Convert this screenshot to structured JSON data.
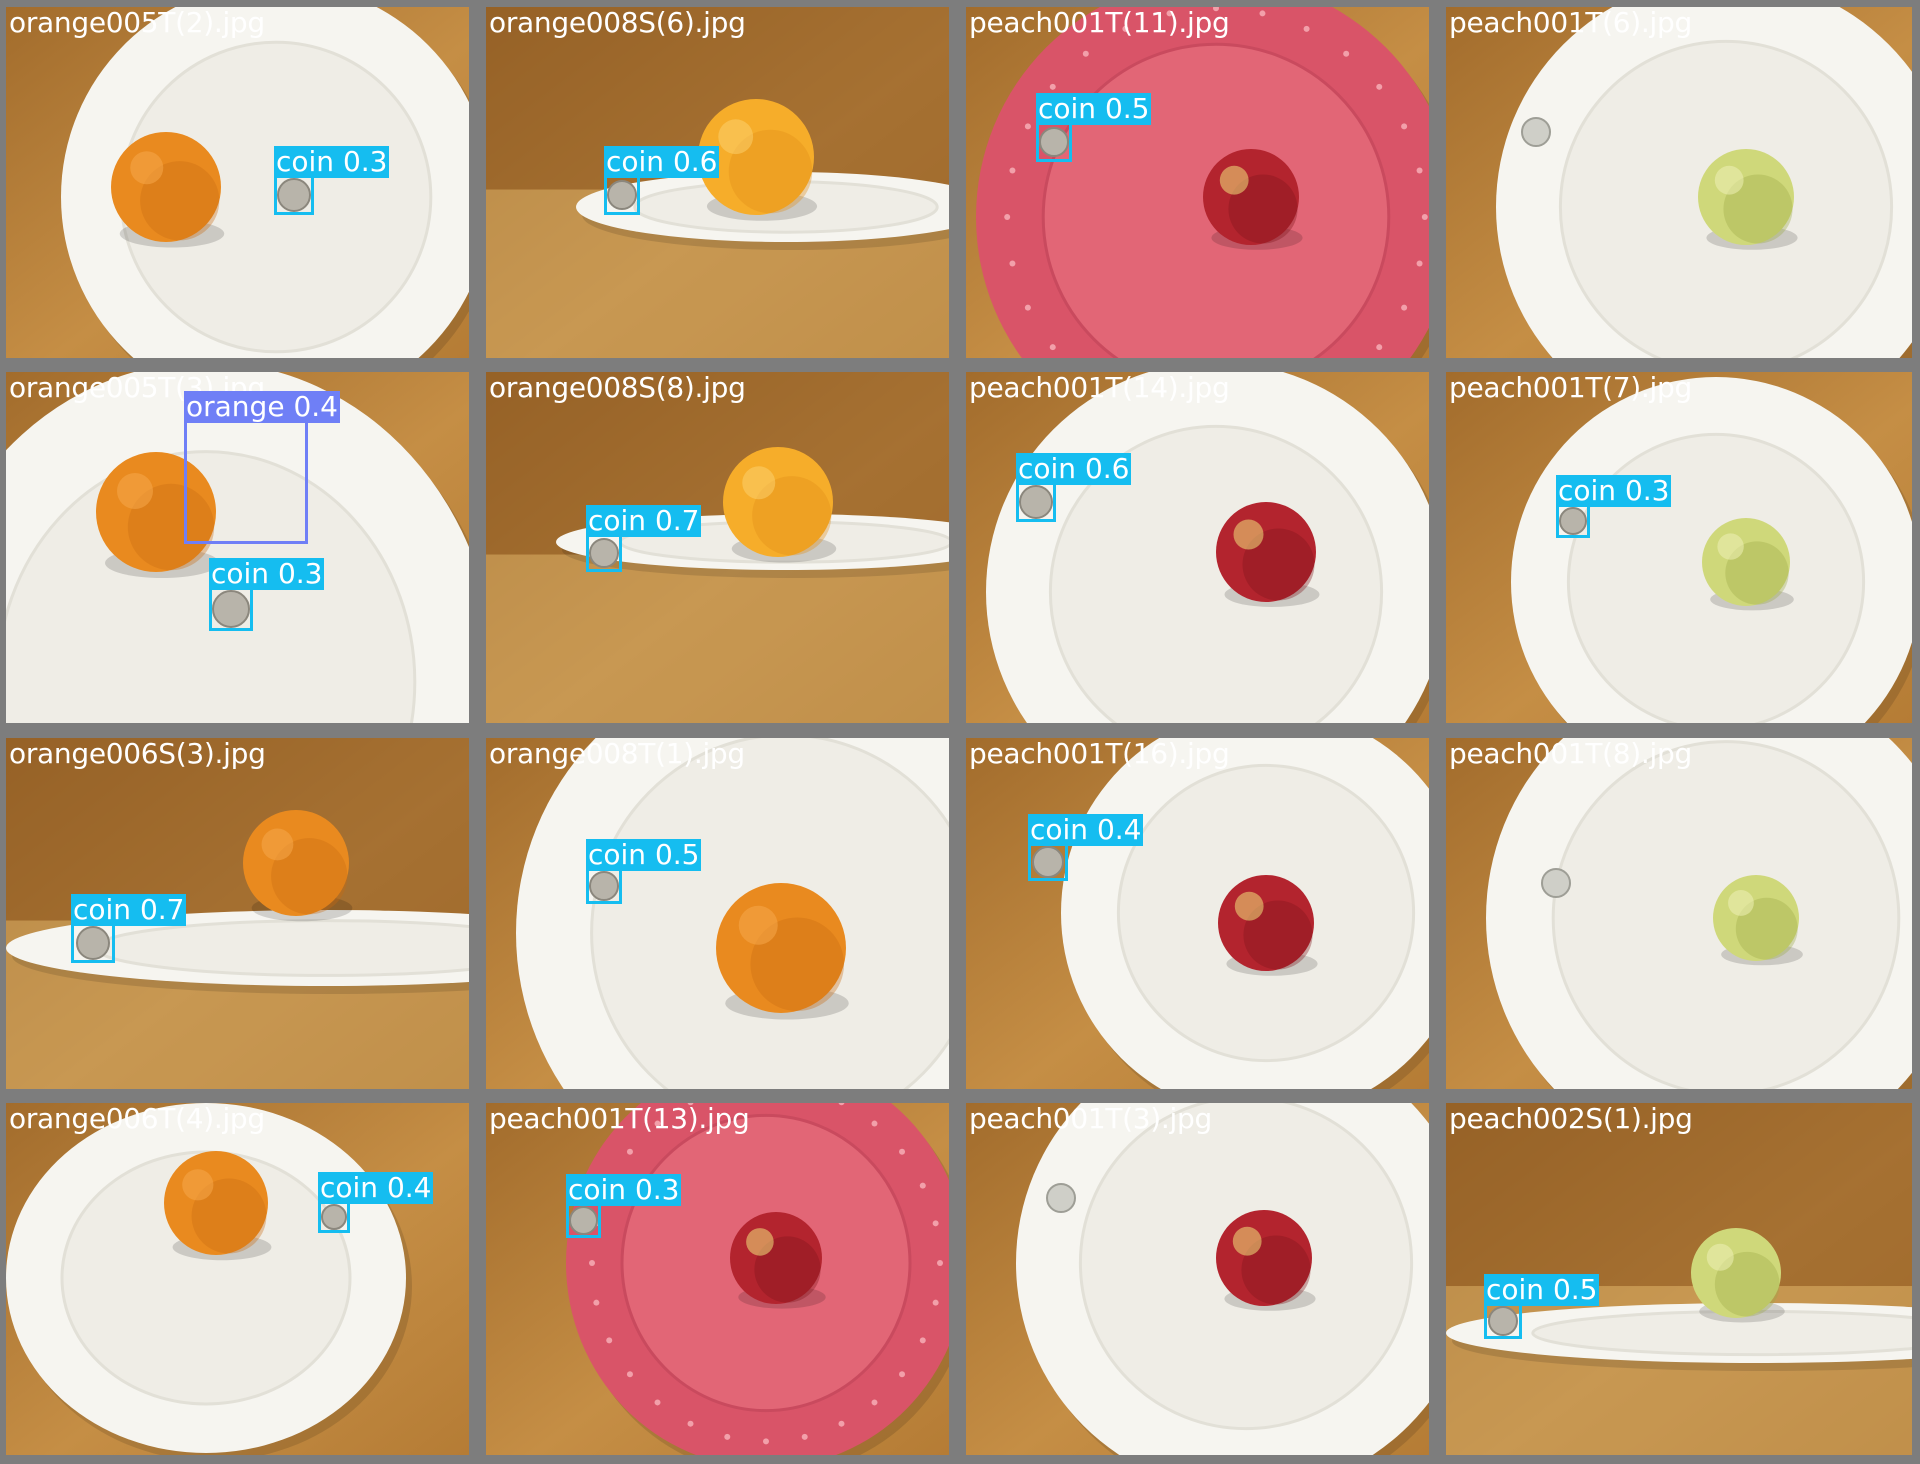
{
  "colors": {
    "coin": "#15bdf0",
    "orange": "#6f7ff6",
    "border": "#7d7d7d"
  },
  "tiles": [
    {
      "filename": "orange005T(2).jpg",
      "scene": "top",
      "plate": "white",
      "fruit": "orange",
      "detections": [
        {
          "label": "coin 0.3",
          "cls": "coin"
        }
      ]
    },
    {
      "filename": "orange008S(6).jpg",
      "scene": "side",
      "plate": "white",
      "fruit": "orange-yellow",
      "detections": [
        {
          "label": "coin 0.6",
          "cls": "coin"
        }
      ]
    },
    {
      "filename": "peach001T(11).jpg",
      "scene": "top",
      "plate": "pink",
      "fruit": "red-peach",
      "detections": [
        {
          "label": "coin 0.5",
          "cls": "coin"
        }
      ]
    },
    {
      "filename": "peach001T(6).jpg",
      "scene": "top",
      "plate": "white",
      "fruit": "green-peach",
      "detections": []
    },
    {
      "filename": "orange005T(3).jpg",
      "scene": "top",
      "plate": "white",
      "fruit": "orange",
      "detections": [
        {
          "label": "orange 0.4",
          "cls": "orange"
        },
        {
          "label": "coin 0.3",
          "cls": "coin"
        }
      ]
    },
    {
      "filename": "orange008S(8).jpg",
      "scene": "side",
      "plate": "white",
      "fruit": "orange-yellow",
      "detections": [
        {
          "label": "coin 0.7",
          "cls": "coin"
        }
      ]
    },
    {
      "filename": "peach001T(14).jpg",
      "scene": "top",
      "plate": "white",
      "fruit": "red-peach",
      "detections": [
        {
          "label": "coin 0.6",
          "cls": "coin"
        }
      ]
    },
    {
      "filename": "peach001T(7).jpg",
      "scene": "top",
      "plate": "white",
      "fruit": "green-peach",
      "detections": [
        {
          "label": "coin 0.3",
          "cls": "coin"
        }
      ]
    },
    {
      "filename": "orange006S(3).jpg",
      "scene": "side",
      "plate": "white",
      "fruit": "orange",
      "detections": [
        {
          "label": "coin 0.7",
          "cls": "coin"
        }
      ]
    },
    {
      "filename": "orange008T(1).jpg",
      "scene": "top",
      "plate": "white",
      "fruit": "orange",
      "detections": [
        {
          "label": "coin 0.5",
          "cls": "coin"
        }
      ]
    },
    {
      "filename": "peach001T(16).jpg",
      "scene": "top",
      "plate": "white",
      "fruit": "red-peach",
      "detections": [
        {
          "label": "coin 0.4",
          "cls": "coin"
        }
      ]
    },
    {
      "filename": "peach001T(8).jpg",
      "scene": "top",
      "plate": "white",
      "fruit": "green-peach",
      "detections": []
    },
    {
      "filename": "orange006T(4).jpg",
      "scene": "top",
      "plate": "white",
      "fruit": "orange",
      "detections": [
        {
          "label": "coin 0.4",
          "cls": "coin"
        }
      ]
    },
    {
      "filename": "peach001T(13).jpg",
      "scene": "top",
      "plate": "pink",
      "fruit": "red-peach",
      "detections": [
        {
          "label": "coin 0.3",
          "cls": "coin"
        }
      ]
    },
    {
      "filename": "peach001T(3).jpg",
      "scene": "top",
      "plate": "white",
      "fruit": "red-peach",
      "detections": []
    },
    {
      "filename": "peach002S(1).jpg",
      "scene": "side",
      "plate": "white",
      "fruit": "green-peach",
      "detections": [
        {
          "label": "coin 0.5",
          "cls": "coin"
        }
      ]
    }
  ]
}
